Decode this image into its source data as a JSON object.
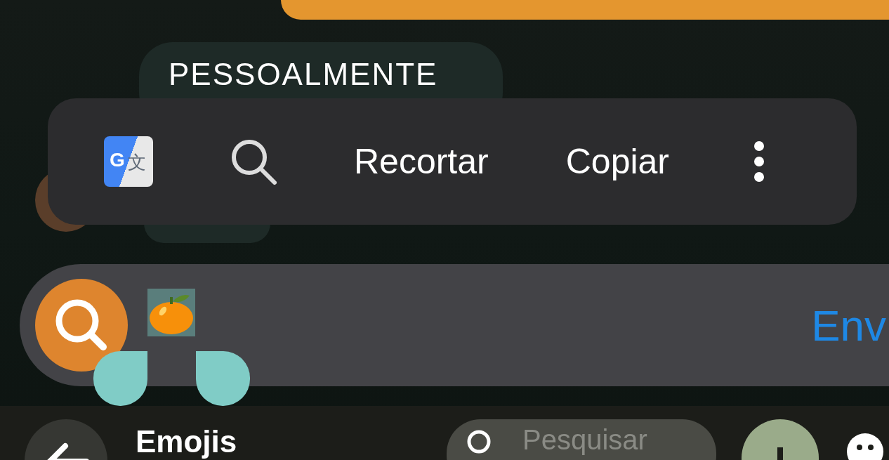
{
  "chat": {
    "message": "PESSOALMENTE"
  },
  "selection_toolbar": {
    "actions": [
      {
        "kind": "translate",
        "glyphs": [
          "G",
          "文"
        ]
      },
      {
        "kind": "search"
      },
      {
        "kind": "text",
        "label": "Recortar"
      },
      {
        "kind": "text",
        "label": "Copiar"
      },
      {
        "kind": "more"
      }
    ]
  },
  "composer": {
    "send": "Env"
  },
  "emoji_panel": {
    "title": "Emojis",
    "search": {
      "placeholder": "Pesquisar"
    }
  }
}
